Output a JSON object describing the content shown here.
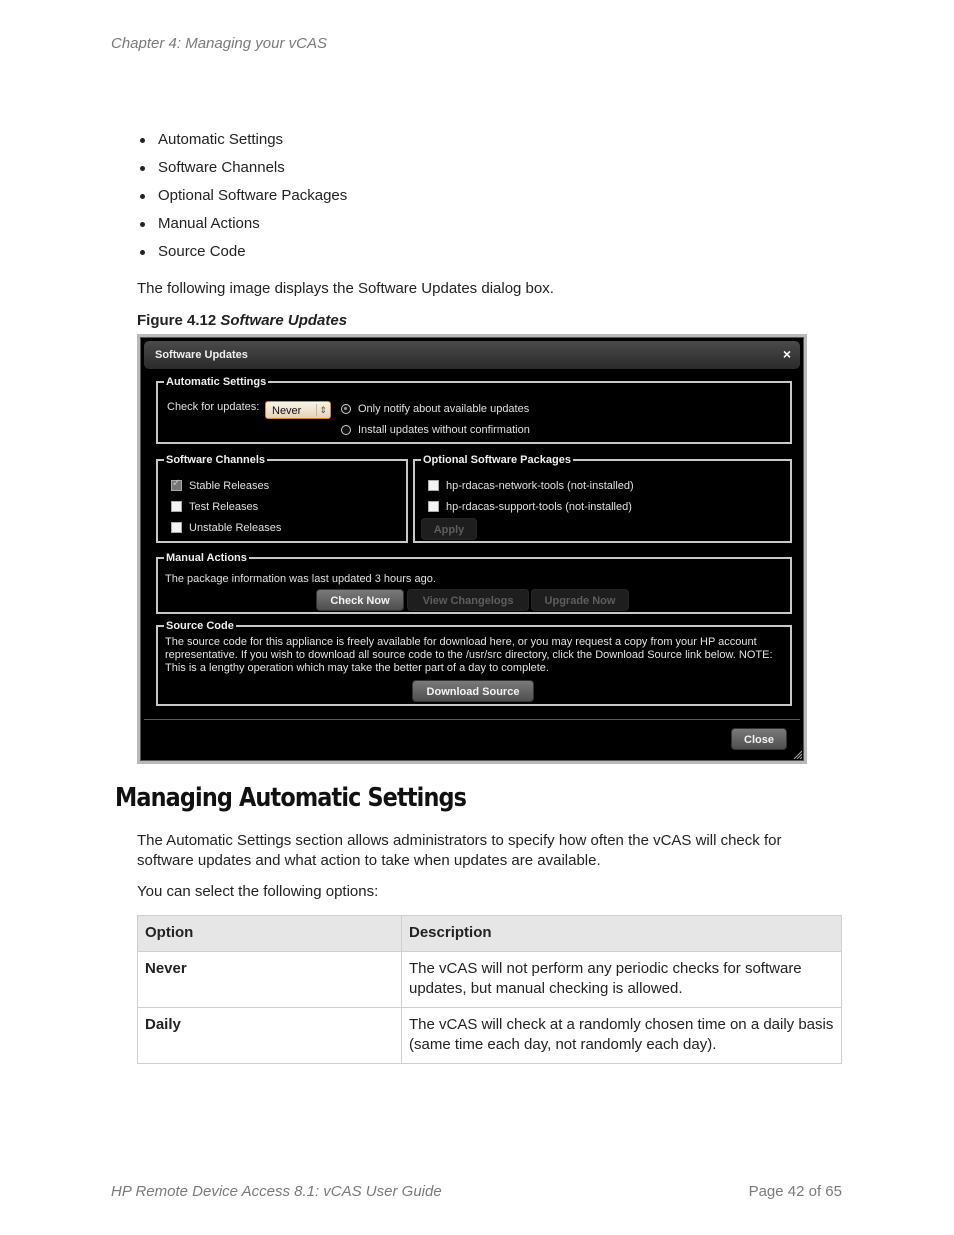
{
  "header": {
    "chapter": "Chapter 4: Managing your vCAS"
  },
  "bullets": [
    "Automatic Settings",
    "Software Channels",
    "Optional Software Packages",
    "Manual Actions",
    "Source Code"
  ],
  "intro": "The following image displays the Software Updates dialog box.",
  "figure": {
    "number": "Figure 4.12",
    "title": "Software Updates"
  },
  "dialog": {
    "title": "Software Updates",
    "close_icon": "×",
    "automatic_settings": {
      "legend": "Automatic Settings",
      "check_label": "Check for updates:",
      "check_value": "Never",
      "options": [
        {
          "label": "Only notify about available updates",
          "selected": true
        },
        {
          "label": "Install updates without confirmation",
          "selected": false
        }
      ]
    },
    "software_channels": {
      "legend": "Software Channels",
      "items": [
        {
          "label": "Stable Releases",
          "checked": true
        },
        {
          "label": "Test Releases",
          "checked": false
        },
        {
          "label": "Unstable Releases",
          "checked": false
        }
      ]
    },
    "optional_packages": {
      "legend": "Optional Software Packages",
      "items": [
        {
          "label": "hp-rdacas-network-tools (not-installed)",
          "checked": false
        },
        {
          "label": "hp-rdacas-support-tools (not-installed)",
          "checked": false
        }
      ],
      "apply_label": "Apply"
    },
    "manual_actions": {
      "legend": "Manual Actions",
      "status": "The package information was last updated 3 hours ago.",
      "check_now": "Check Now",
      "view_changelogs": "View Changelogs",
      "upgrade_now": "Upgrade Now"
    },
    "source_code": {
      "legend": "Source Code",
      "text": "The source code for this appliance is freely available for download here, or you may request a copy from your HP account representative. If you wish to download all source code to the /usr/src directory, click the Download Source link below. NOTE: This is a lengthy operation which may take the better part of a day to complete.",
      "download_label": "Download Source"
    },
    "close_label": "Close"
  },
  "section": {
    "heading": "Managing Automatic Settings",
    "para1": "The Automatic Settings section allows administrators to specify how often the vCAS will check for software updates and what action to take when updates are available.",
    "para2": "You can select the following options:"
  },
  "table": {
    "headers": [
      "Option",
      "Description"
    ],
    "rows": [
      {
        "option": "Never",
        "description": "The vCAS will not perform any periodic checks for software updates, but manual checking is allowed."
      },
      {
        "option": "Daily",
        "description": "The vCAS will check at a randomly chosen time on a daily basis (same time each day, not randomly each day)."
      }
    ]
  },
  "footer": {
    "guide": "HP Remote Device Access 8.1: vCAS User Guide",
    "page": "Page 42 of 65"
  }
}
